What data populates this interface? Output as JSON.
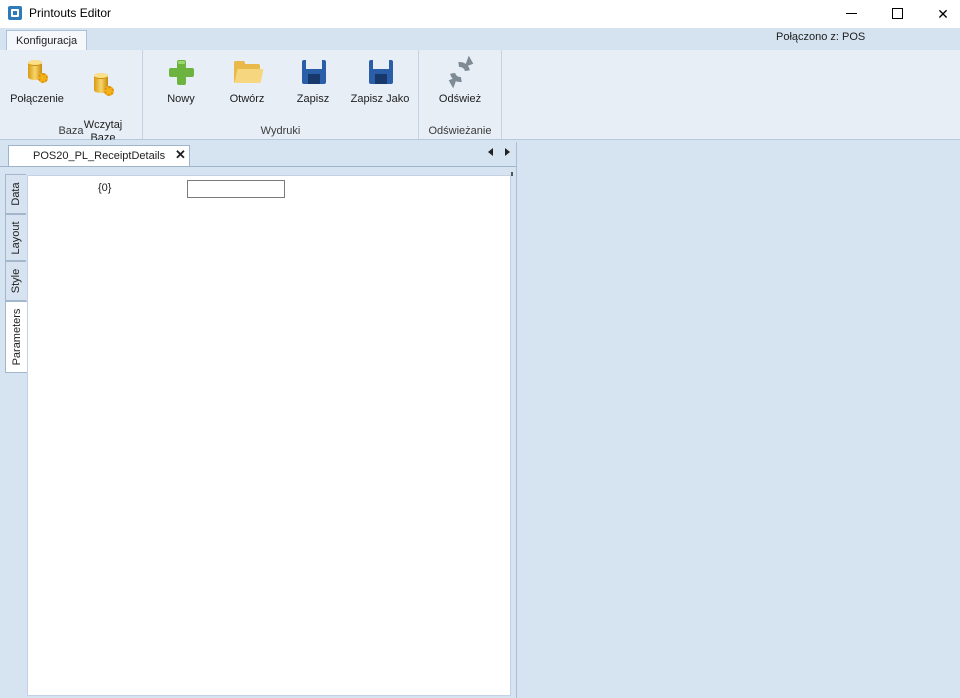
{
  "window": {
    "title": "Printouts Editor"
  },
  "ribbon": {
    "tabs": [
      "Konfiguracja"
    ],
    "connection_status": "Połączono z: POS",
    "groups": [
      {
        "label": "Baza",
        "buttons": [
          {
            "label": "Połączenie",
            "icon": "database-gear-icon"
          },
          {
            "label": "Wczytaj\nBazę",
            "icon": "database-gear-icon"
          }
        ]
      },
      {
        "label": "Wydruki",
        "buttons": [
          {
            "label": "Nowy",
            "icon": "plus-icon"
          },
          {
            "label": "Otwórz",
            "icon": "folder-open-icon"
          },
          {
            "label": "Zapisz",
            "icon": "save-icon"
          },
          {
            "label": "Zapisz Jako",
            "icon": "save-as-icon"
          }
        ]
      },
      {
        "label": "Odświeżanie",
        "buttons": [
          {
            "label": "Odśwież",
            "icon": "refresh-icon"
          }
        ]
      }
    ]
  },
  "document": {
    "tab_label": "POS20_PL_ReceiptDetails",
    "side_tabs": [
      "Data",
      "Layout",
      "Style",
      "Parameters"
    ],
    "active_side_tab": "Parameters",
    "parameters": [
      {
        "label": "{0}",
        "value": ""
      }
    ]
  }
}
